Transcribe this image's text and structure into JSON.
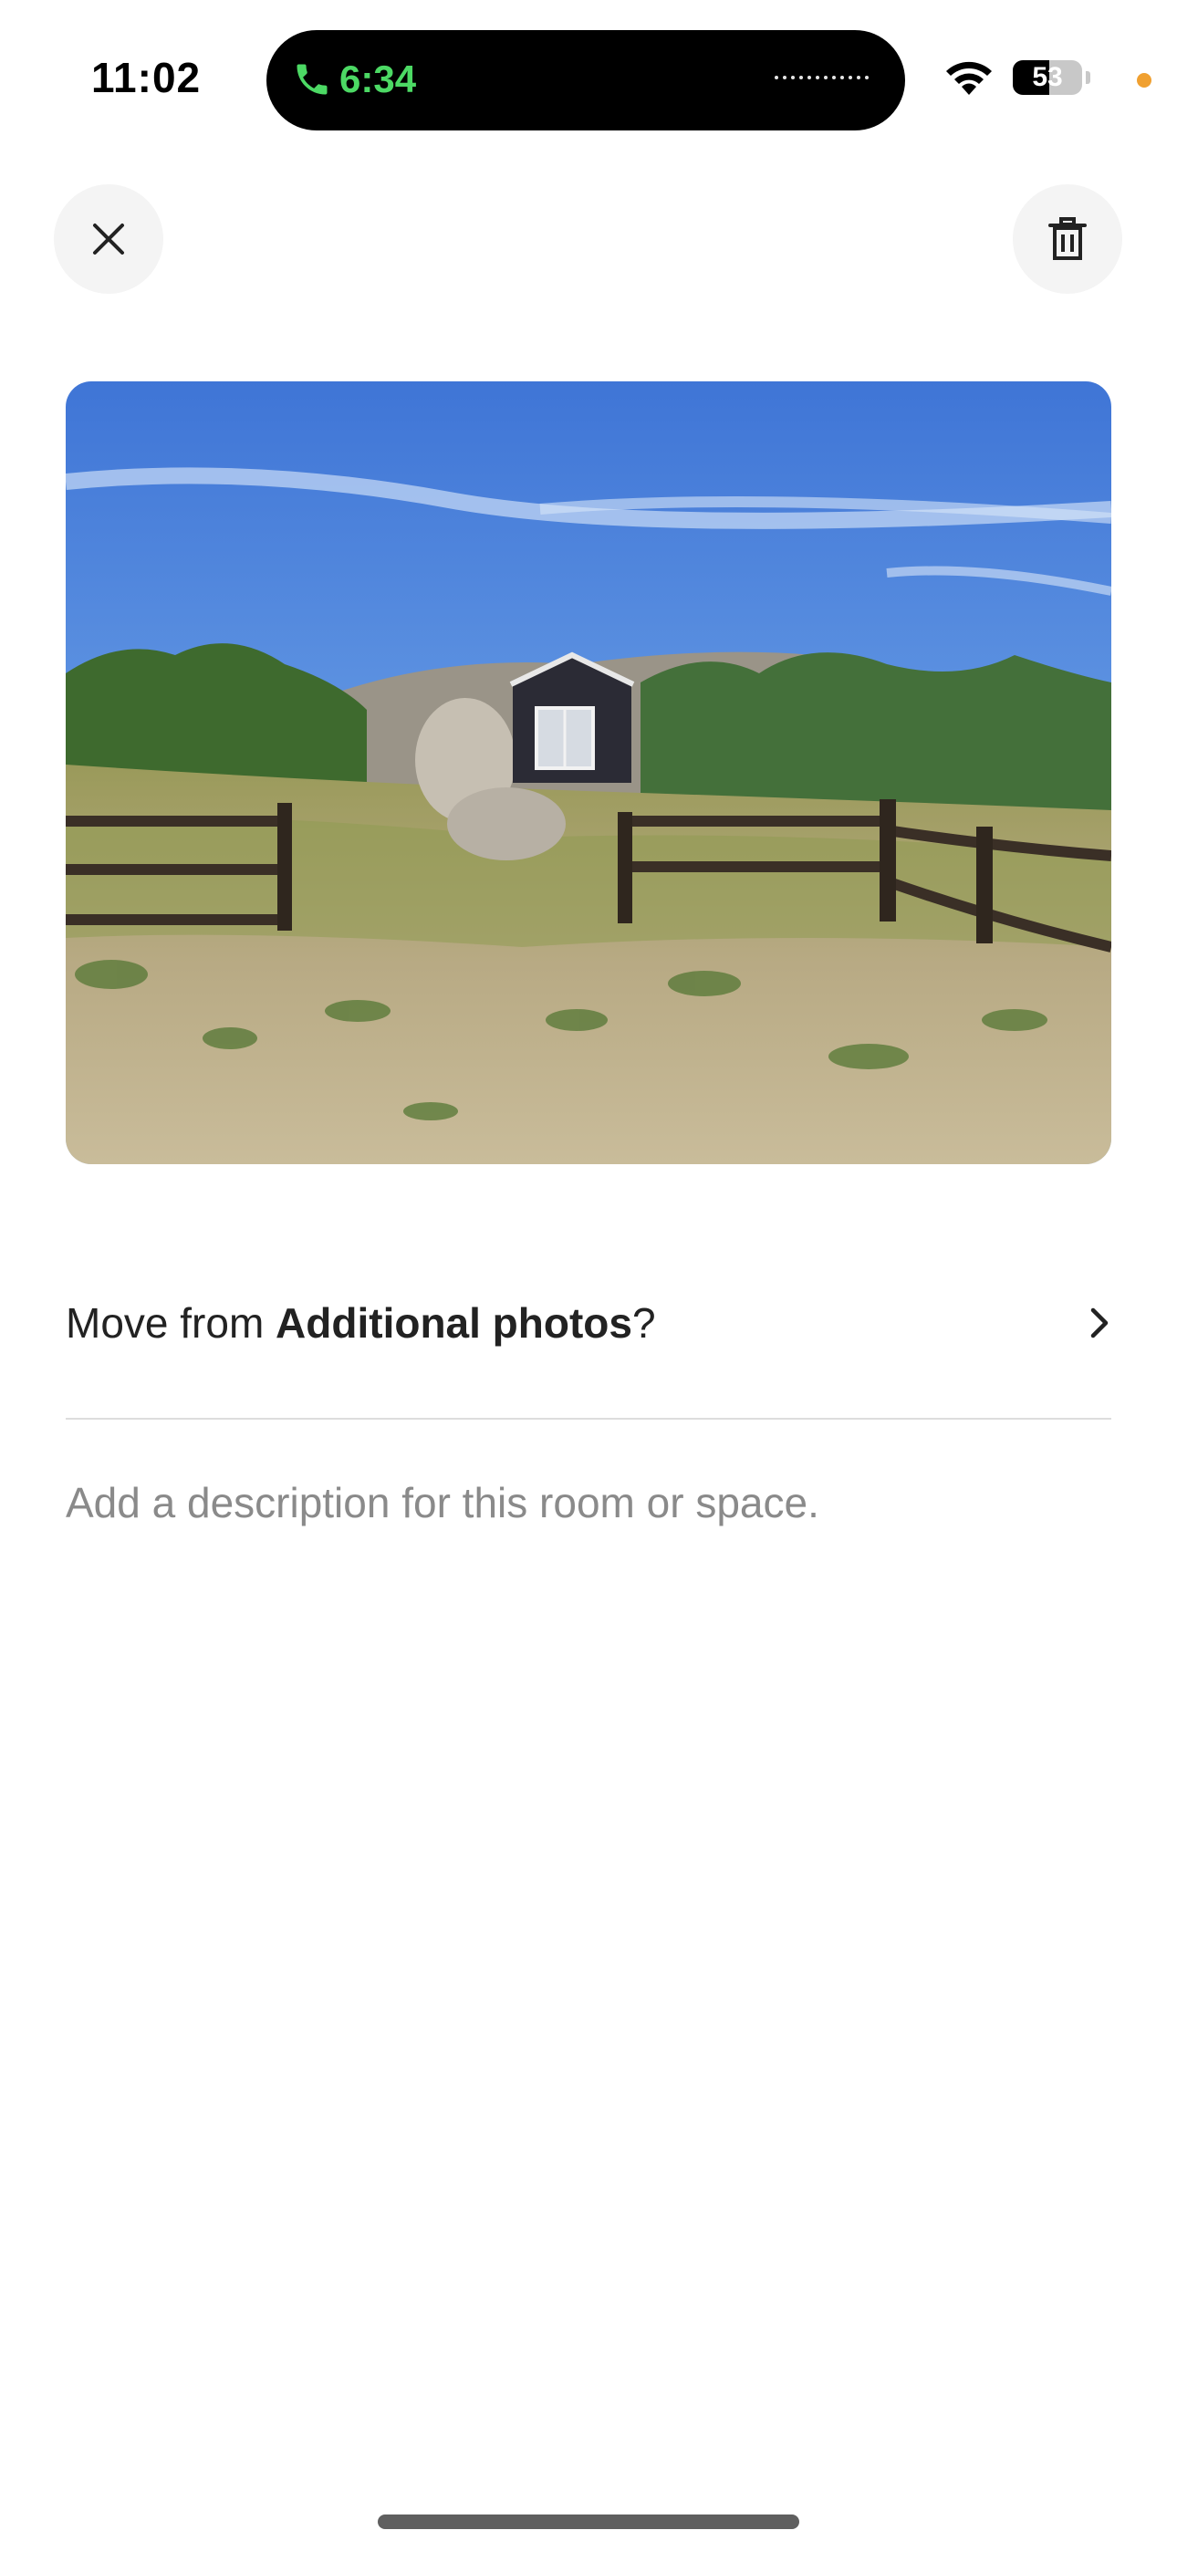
{
  "status_bar": {
    "time": "11:02",
    "call_duration": "6:34",
    "battery_level": "53",
    "battery_percent": 53,
    "call_color": "#4cd964",
    "privacy_dot_color": "#f0a030"
  },
  "header": {
    "close_icon": "close-icon",
    "delete_icon": "trash-icon"
  },
  "photo": {
    "icon": "photo-of-tiny-cabin-with-fence"
  },
  "move_row": {
    "prefix": "Move from ",
    "category": "Additional photos",
    "suffix": "?",
    "icon": "chevron-right-icon"
  },
  "description": {
    "placeholder": "Add a description for this room or space."
  }
}
